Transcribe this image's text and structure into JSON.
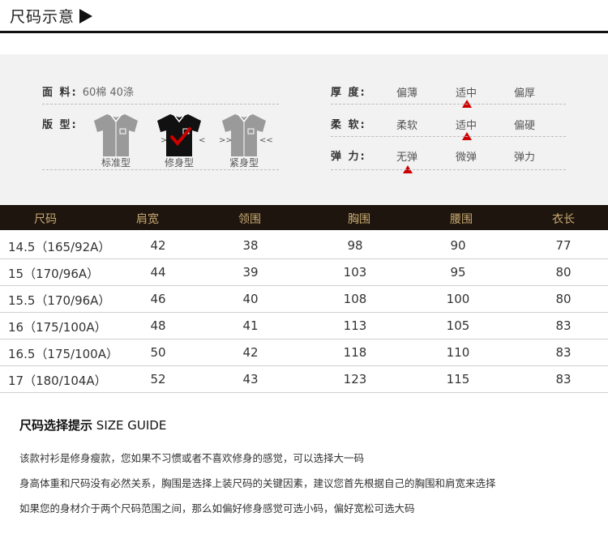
{
  "header": {
    "title": "尺码示意"
  },
  "specs": {
    "fabric": {
      "label": "面  料:",
      "value": "60棉 40涤"
    },
    "fit": {
      "label": "版  型:",
      "options": [
        "标准型",
        "修身型",
        "紧身型"
      ],
      "selected": "修身型"
    },
    "thickness": {
      "label": "厚  度:",
      "options": [
        "偏薄",
        "适中",
        "偏厚"
      ],
      "selected": "适中"
    },
    "softness": {
      "label": "柔  软:",
      "options": [
        "柔软",
        "适中",
        "偏硬"
      ],
      "selected": "适中"
    },
    "elasticity": {
      "label": "弹  力:",
      "options": [
        "无弹",
        "微弹",
        "弹力"
      ],
      "selected": "无弹"
    }
  },
  "colors": {
    "marker": "#cc0000",
    "table_header_bg": "#1e160e",
    "table_header_text": "#c9a972",
    "check": "#cc0000"
  },
  "chart_data": {
    "type": "table",
    "columns": [
      "尺码",
      "肩宽",
      "领围",
      "胸围",
      "腰围",
      "衣长"
    ],
    "rows": [
      [
        "14.5（165/92A）",
        "42",
        "38",
        "98",
        "90",
        "77"
      ],
      [
        "15（170/96A）",
        "44",
        "39",
        "103",
        "95",
        "80"
      ],
      [
        "15.5（170/96A）",
        "46",
        "40",
        "108",
        "100",
        "80"
      ],
      [
        "16（175/100A）",
        "48",
        "41",
        "113",
        "105",
        "83"
      ],
      [
        "16.5（175/100A）",
        "50",
        "42",
        "118",
        "110",
        "83"
      ],
      [
        "17（180/104A）",
        "52",
        "43",
        "123",
        "115",
        "83"
      ]
    ]
  },
  "guide": {
    "title_cn": "尺码选择提示",
    "title_en": "SIZE GUIDE",
    "lines": [
      "该款衬衫是修身瘦款，您如果不习惯或者不喜欢修身的感觉，可以选择大一码",
      "身高体重和尺码没有必然关系，胸围是选择上装尺码的关键因素，建议您首先根据自己的胸围和肩宽来选择",
      "如果您的身材介于两个尺码范围之间，那么如偏好修身感觉可选小码，偏好宽松可选大码"
    ]
  }
}
